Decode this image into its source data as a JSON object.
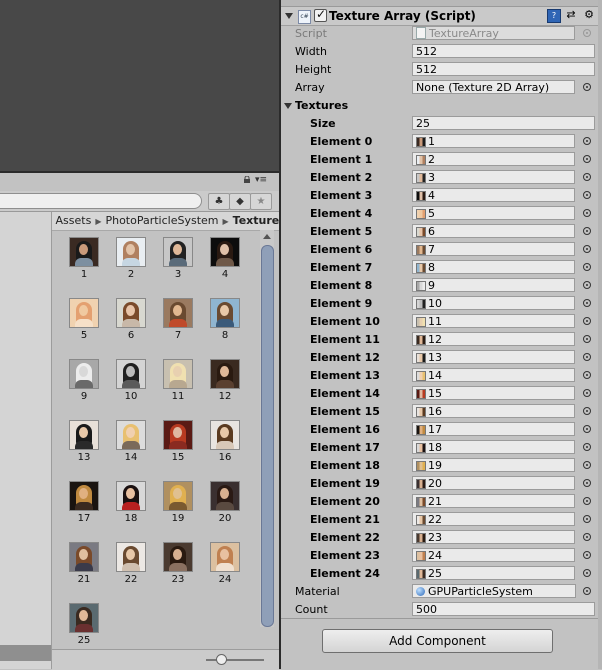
{
  "project": {
    "breadcrumb": [
      "Assets",
      "PhotoParticleSystem",
      "Textures"
    ],
    "items": [
      "1",
      "2",
      "3",
      "4",
      "5",
      "6",
      "7",
      "8",
      "9",
      "10",
      "11",
      "12",
      "13",
      "14",
      "15",
      "16",
      "17",
      "18",
      "19",
      "20",
      "21",
      "22",
      "23",
      "24",
      "25"
    ]
  },
  "inspector": {
    "component": {
      "title": "Texture Array (Script)",
      "enabled": true,
      "icon_text": "c#"
    },
    "script": {
      "label": "Script",
      "value": "TextureArray"
    },
    "width": {
      "label": "Width",
      "value": "512"
    },
    "height": {
      "label": "Height",
      "value": "512"
    },
    "array": {
      "label": "Array",
      "value": "None (Texture 2D Array)"
    },
    "textures": {
      "label": "Textures",
      "size_label": "Size",
      "size_value": "25",
      "elements": [
        {
          "label": "Element 0",
          "value": "1"
        },
        {
          "label": "Element 1",
          "value": "2"
        },
        {
          "label": "Element 2",
          "value": "3"
        },
        {
          "label": "Element 3",
          "value": "4"
        },
        {
          "label": "Element 4",
          "value": "5"
        },
        {
          "label": "Element 5",
          "value": "6"
        },
        {
          "label": "Element 6",
          "value": "7"
        },
        {
          "label": "Element 7",
          "value": "8"
        },
        {
          "label": "Element 8",
          "value": "9"
        },
        {
          "label": "Element 9",
          "value": "10"
        },
        {
          "label": "Element 10",
          "value": "11"
        },
        {
          "label": "Element 11",
          "value": "12"
        },
        {
          "label": "Element 12",
          "value": "13"
        },
        {
          "label": "Element 13",
          "value": "14"
        },
        {
          "label": "Element 14",
          "value": "15"
        },
        {
          "label": "Element 15",
          "value": "16"
        },
        {
          "label": "Element 16",
          "value": "17"
        },
        {
          "label": "Element 17",
          "value": "18"
        },
        {
          "label": "Element 18",
          "value": "19"
        },
        {
          "label": "Element 19",
          "value": "20"
        },
        {
          "label": "Element 20",
          "value": "21"
        },
        {
          "label": "Element 21",
          "value": "22"
        },
        {
          "label": "Element 22",
          "value": "23"
        },
        {
          "label": "Element 23",
          "value": "24"
        },
        {
          "label": "Element 24",
          "value": "25"
        }
      ]
    },
    "material": {
      "label": "Material",
      "value": "GPUParticleSystem"
    },
    "count": {
      "label": "Count",
      "value": "500"
    },
    "add_component": "Add Component"
  },
  "thumb_palette": [
    [
      "#3a2a22",
      "#c99a7a",
      "#1a1a1a",
      "#7d8fa0"
    ],
    [
      "#e9eef2",
      "#e2c3a8",
      "#b08060",
      "#c6d6e2"
    ],
    [
      "#c7c7c7",
      "#e0b898",
      "#222222",
      "#5a6b7a"
    ],
    [
      "#0d0d0d",
      "#e0c0a8",
      "#2a1a12",
      "#6e5848"
    ],
    [
      "#f0d2b0",
      "#f0c9a0",
      "#e4a070",
      "#f6e0c8"
    ],
    [
      "#d8d8d0",
      "#e8c4a8",
      "#7a4a2a",
      "#c8b8a8"
    ],
    [
      "#9a7a60",
      "#e2b890",
      "#6a4a30",
      "#c04a2a"
    ],
    [
      "#8fb5d0",
      "#e8c8a8",
      "#6a4a30",
      "#3a5a7a"
    ],
    [
      "#a8a8a8",
      "#d8d8d8",
      "#ececec",
      "#6a6a6a"
    ],
    [
      "#d4d4d4",
      "#bcbcbc",
      "#202020",
      "#5a5a5a"
    ],
    [
      "#c8c0b0",
      "#e8d0b0",
      "#f0e0b0",
      "#b8a890"
    ],
    [
      "#3a2a20",
      "#e0b898",
      "#2a1a10",
      "#5a4030"
    ],
    [
      "#e8e0d8",
      "#e8c8a8",
      "#1a1a1a",
      "#2a2a2a"
    ],
    [
      "#dcdcdc",
      "#f0d0b0",
      "#e8c070",
      "#7a6a5a"
    ],
    [
      "#5a1a14",
      "#e0b8a0",
      "#b83a20",
      "#8a2a20"
    ],
    [
      "#e8e4e0",
      "#e8c8a8",
      "#5a3a20",
      "#d8c8b8"
    ],
    [
      "#1a1410",
      "#e0b080",
      "#c08a40",
      "#3a2a20"
    ],
    [
      "#d8d8d8",
      "#e8c0a0",
      "#1a1010",
      "#b82020"
    ],
    [
      "#b09060",
      "#e0c090",
      "#e0b050",
      "#7a5a30"
    ],
    [
      "#3a3030",
      "#d8b090",
      "#2a1a14",
      "#5a4a40"
    ],
    [
      "#7a7a82",
      "#e0c0a0",
      "#7a4a2a",
      "#3a3a4a"
    ],
    [
      "#ece8e4",
      "#e8c8a8",
      "#6a4a30",
      "#d0c0b0"
    ],
    [
      "#4a3a30",
      "#d8b090",
      "#2a1a10",
      "#8a7060"
    ],
    [
      "#dcc0a0",
      "#e8c0a0",
      "#c08050",
      "#f0e0d0"
    ],
    [
      "#5a6a70",
      "#e0b898",
      "#3a2a20",
      "#6a3030"
    ]
  ]
}
